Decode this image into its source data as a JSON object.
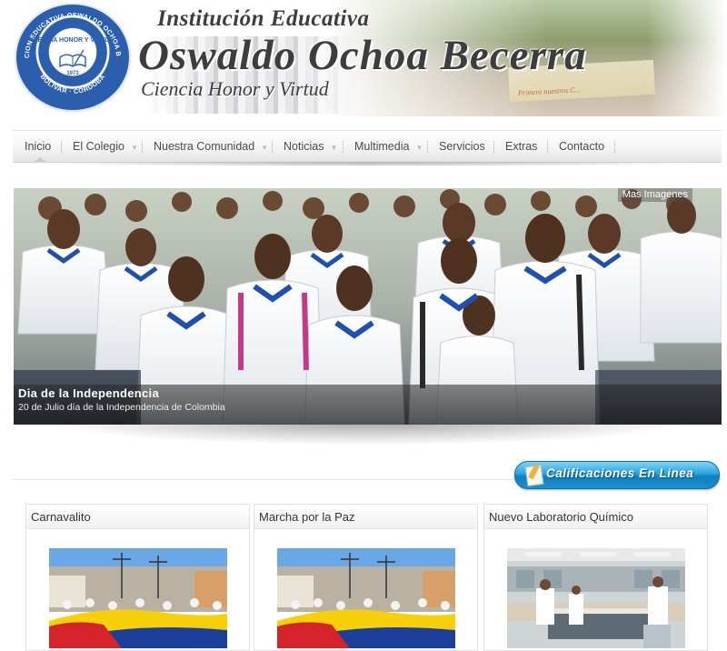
{
  "header": {
    "logo_ring_text": "INSTITUCION EDUCATIVA OSWALDO OCHOA BECERRA",
    "logo_center_text": "CIENCIA HONOR Y VIRTUD",
    "logo_year": "1973",
    "logo_bottom_text": "BOLIVAR · CORDOBA",
    "title_top": "Institución Educativa",
    "title_main": "Oswaldo Ochoa Becerra",
    "motto": "Ciencia Honor y Virtud",
    "banner_text": "Primero nuestros C..."
  },
  "nav": {
    "items": [
      {
        "label": "Inicio",
        "has_dropdown": false
      },
      {
        "label": "El Colegio",
        "has_dropdown": true
      },
      {
        "label": "Nuestra Comunidad",
        "has_dropdown": true
      },
      {
        "label": "Noticias",
        "has_dropdown": true
      },
      {
        "label": "Multimedia",
        "has_dropdown": true
      },
      {
        "label": "Servicios",
        "has_dropdown": false
      },
      {
        "label": "Extras",
        "has_dropdown": false
      },
      {
        "label": "Contacto",
        "has_dropdown": false
      }
    ],
    "active": "Inicio"
  },
  "slideshow": {
    "more_link": "Mas Imagenes",
    "caption_title": "Dia de la Independencia",
    "caption_desc": "20 de Julio día de la Independencia de Colombia"
  },
  "calificaciones": {
    "label": "Calificaciones En Linea"
  },
  "cards": [
    {
      "title": "Carnavalito"
    },
    {
      "title": "Marcha por la Paz"
    },
    {
      "title": "Nuevo Laboratorio Químico"
    }
  ],
  "colors": {
    "logo_blue": "#2b5fae",
    "button_blue": "#2aa3dc",
    "flag_yellow": "#f6d10b",
    "flag_blue": "#1d3f9c",
    "flag_red": "#d6222b"
  }
}
